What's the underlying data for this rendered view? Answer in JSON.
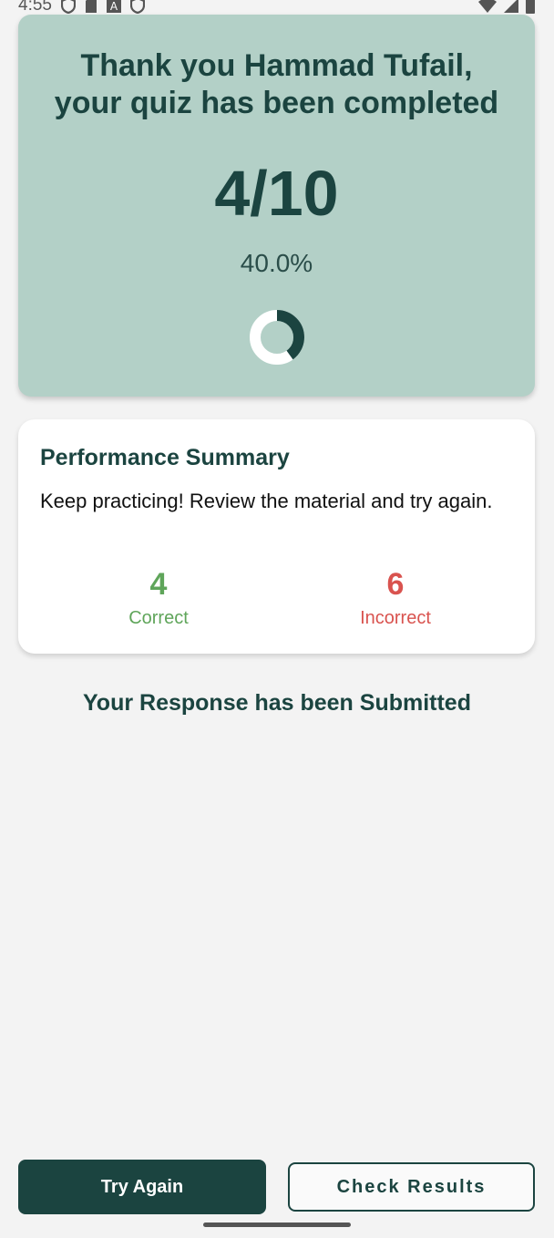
{
  "status_bar": {
    "time": "4:55",
    "left_icons": [
      "shield-icon",
      "sd-card-icon",
      "font-a-icon",
      "shield-icon"
    ],
    "right_icons": [
      "wifi-icon",
      "cell-signal-icon",
      "battery-icon"
    ]
  },
  "result": {
    "thanks_line1": "Thank you Hammad Tufail,",
    "thanks_line2": "your quiz has been completed",
    "score": "4/10",
    "percent": "40.0%",
    "progress_fraction": 0.4
  },
  "summary": {
    "title": "Performance Summary",
    "message": "Keep practicing! Review the material and try again.",
    "correct_count": "4",
    "correct_label": "Correct",
    "incorrect_count": "6",
    "incorrect_label": "Incorrect"
  },
  "submitted_text": "Your Response has been Submitted",
  "buttons": {
    "try_again": "Try Again",
    "check_results": "Check Results"
  },
  "colors": {
    "primary": "#1b4440",
    "card_bg": "#b3d0c7",
    "correct": "#5fa55a",
    "incorrect": "#d9534f"
  }
}
